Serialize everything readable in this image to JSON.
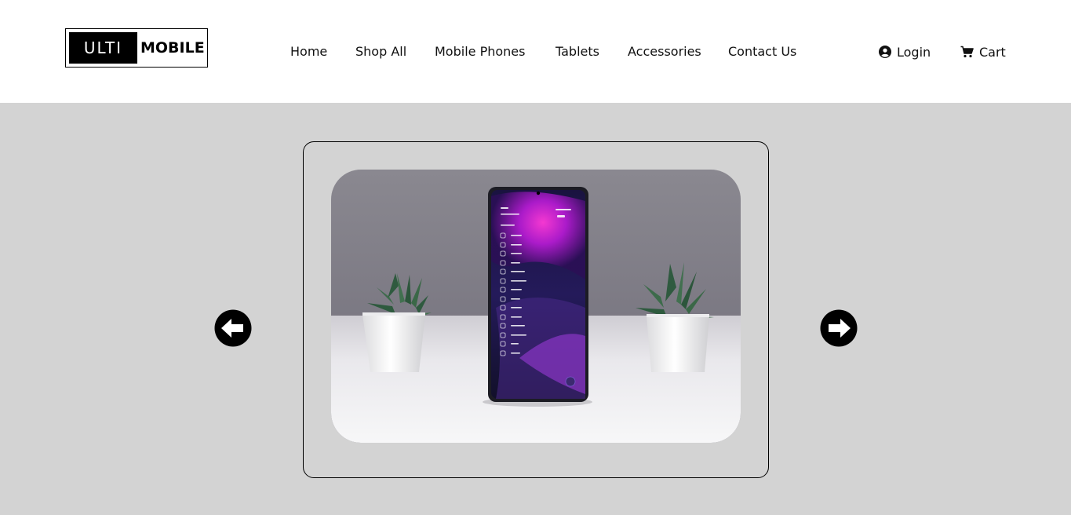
{
  "brand": {
    "left": "ULTI",
    "right": "MOBILE"
  },
  "nav": {
    "items": [
      {
        "label": "Home"
      },
      {
        "label": "Shop All"
      },
      {
        "label": "Mobile Phones"
      },
      {
        "label": "Tablets"
      },
      {
        "label": "Accessories"
      },
      {
        "label": "Contact Us"
      }
    ]
  },
  "user_actions": {
    "login_label": "Login",
    "cart_label": "Cart"
  },
  "icons": {
    "login": "user-circle-icon",
    "cart": "shopping-cart-icon",
    "prev": "arrow-left-circle-icon",
    "next": "arrow-right-circle-icon"
  },
  "colors": {
    "header_bg": "#ffffff",
    "page_bg": "#d3d3d3",
    "accent": "#000000",
    "screen_glow": "#b81cc9"
  }
}
